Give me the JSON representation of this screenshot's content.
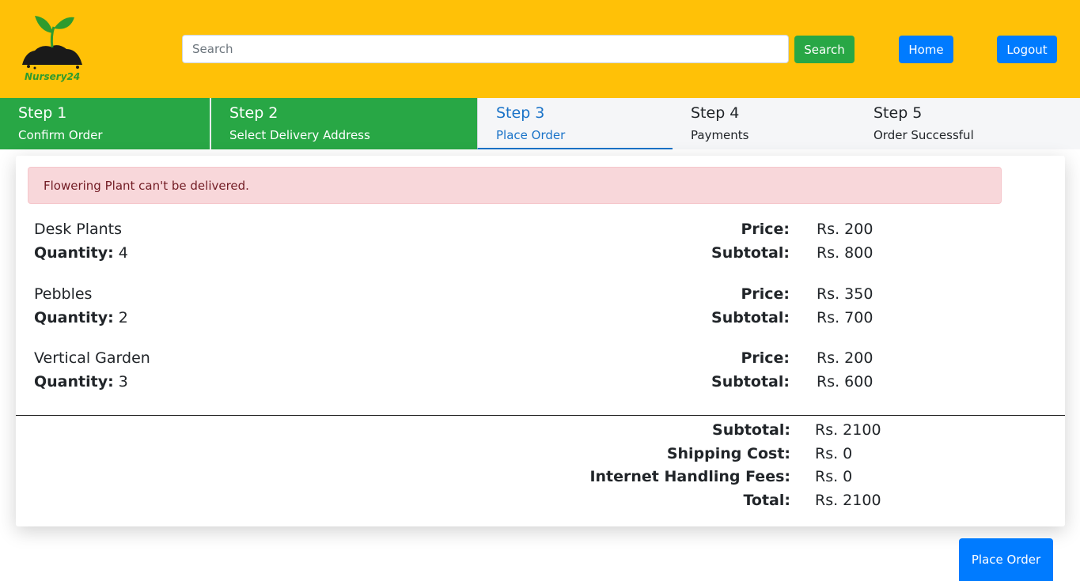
{
  "header": {
    "logo_text": "Nursery24",
    "search_placeholder": "Search",
    "search_button": "Search",
    "home_button": "Home",
    "logout_button": "Logout"
  },
  "steps": [
    {
      "title": "Step 1",
      "subtitle": "Confirm Order",
      "state": "done"
    },
    {
      "title": "Step 2",
      "subtitle": "Select Delivery Address",
      "state": "done"
    },
    {
      "title": "Step 3",
      "subtitle": "Place Order",
      "state": "active"
    },
    {
      "title": "Step 4",
      "subtitle": "Payments",
      "state": "pending"
    },
    {
      "title": "Step 5",
      "subtitle": "Order Successful",
      "state": "pending"
    }
  ],
  "alert": {
    "message": "Flowering Plant can't be delivered."
  },
  "labels": {
    "quantity": "Quantity:",
    "price": "Price:",
    "subtotal": "Subtotal:"
  },
  "items": [
    {
      "name": "Desk Plants",
      "quantity": "4",
      "price": "Rs. 200",
      "subtotal": "Rs. 800"
    },
    {
      "name": "Pebbles",
      "quantity": "2",
      "price": "Rs. 350",
      "subtotal": "Rs. 700"
    },
    {
      "name": "Vertical Garden",
      "quantity": "3",
      "price": "Rs. 200",
      "subtotal": "Rs. 600"
    }
  ],
  "totals": [
    {
      "label": "Subtotal:",
      "value": "Rs. 2100"
    },
    {
      "label": "Shipping Cost:",
      "value": "Rs. 0"
    },
    {
      "label": "Internet Handling Fees:",
      "value": "Rs. 0"
    },
    {
      "label": "Total:",
      "value": "Rs. 2100"
    }
  ],
  "place_order_button": "Place Order",
  "colors": {
    "header_bg": "#ffc107",
    "step_done": "#28a745",
    "step_active": "#1a73c8",
    "primary": "#007bff",
    "success": "#28a745",
    "alert_bg": "#f8d7da"
  }
}
